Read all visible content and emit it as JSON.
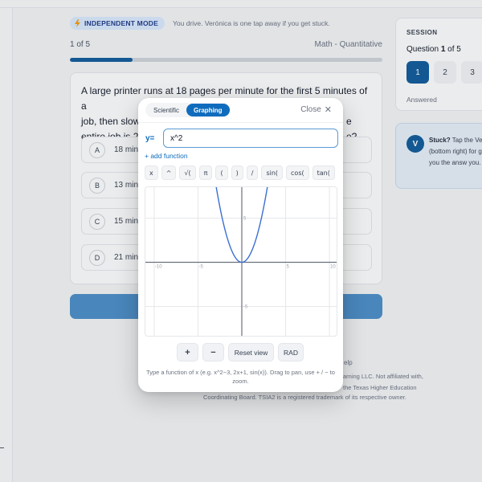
{
  "mode_banner": {
    "badge": "INDEPENDENT MODE",
    "hint": "You drive. Verónica is one tap away if you get stuck."
  },
  "progress": {
    "label": "1 of 5",
    "subject": "Math - Quantitative",
    "fraction": 0.2
  },
  "question": {
    "lines": [
      "A large printer runs at 18 pages per minute for the first 5 minutes of a",
      "job, then slow",
      "entire job is 24"
    ],
    "line_tail_2": "e",
    "line_tail_3": "e?",
    "options": [
      {
        "letter": "A",
        "text": "18 minu"
      },
      {
        "letter": "B",
        "text": "13 minu"
      },
      {
        "letter": "C",
        "text": "15 minu"
      },
      {
        "letter": "D",
        "text": "21 minu"
      }
    ]
  },
  "session": {
    "label": "SESSION",
    "question_prefix": "Question ",
    "question_current": "1",
    "question_suffix": " of 5",
    "numbers": [
      "1",
      "2",
      "3"
    ],
    "answered_label": "Answered"
  },
  "stuck": {
    "avatar": "V",
    "title": "Stuck?",
    "text": " Tap the Ve (bottom right) for give you the answ you."
  },
  "footer": {
    "help": "elp",
    "line1": "arning LLC. Not affiliated with,",
    "line2": "the Texas Higher Education",
    "line3": "Coordinating Board. TSIA2 is a registered trademark of its respective owner."
  },
  "calculator": {
    "tabs": [
      "Scientific",
      "Graphing"
    ],
    "active_tab": "Graphing",
    "close_label": "Close",
    "y_label": "y=",
    "input_value": "x^2",
    "add_function": "+ add function",
    "keys": [
      "x",
      "^",
      "√(",
      "π",
      "(",
      ")",
      "/",
      "sin(",
      "cos(",
      "tan("
    ],
    "zoom_in": "+",
    "zoom_out": "−",
    "reset_view": "Reset view",
    "angle_mode": "RAD",
    "help": "Type a function of x (e.g. x^2−3, 2x+1, sin(x)). Drag to pan, use + / − to zoom."
  },
  "graph": {
    "function": "x^2",
    "x_range": [
      -11,
      11
    ],
    "y_range": [
      -8.5,
      8.5
    ],
    "grid_step": 5,
    "x_tick_labels": [
      "-10",
      "-5",
      "5",
      "10"
    ],
    "y_tick_labels": [
      "5",
      "-5"
    ],
    "curve_color": "#3b6fd1"
  },
  "colors": {
    "accent": "#0f6cbd",
    "progress": "#0f5b9a",
    "submit": "#4b8ec8"
  }
}
